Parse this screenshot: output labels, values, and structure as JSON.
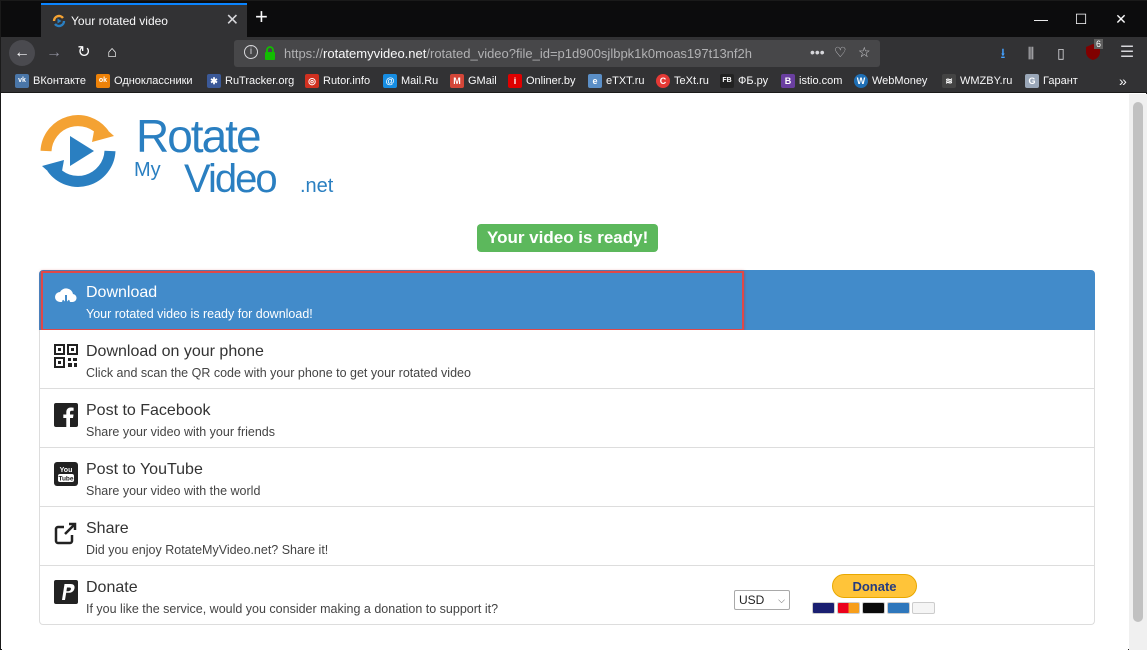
{
  "browser": {
    "tab_title": "Your rotated video",
    "url_prefix": "https://",
    "url_domain": "rotatemyvideo.net",
    "url_path": "/rotated_video?file_id=p1d900sjlbpk1k0moas197t13nf2h",
    "ublock_count": "6"
  },
  "bookmarks": [
    {
      "label": "ВКонтакте",
      "color": "#4a76a8",
      "glyph": "vk"
    },
    {
      "label": "Одноклассники",
      "color": "#ee8208",
      "glyph": "ok"
    },
    {
      "label": "RuTracker.org",
      "color": "#3b5998",
      "glyph": "✱"
    },
    {
      "label": "Rutor.info",
      "color": "#d03020",
      "glyph": "◎"
    },
    {
      "label": "Mail.Ru",
      "color": "#168de2",
      "glyph": "@"
    },
    {
      "label": "GMail",
      "color": "#d44638",
      "glyph": "M"
    },
    {
      "label": "Onliner.by",
      "color": "#e00000",
      "glyph": "i"
    },
    {
      "label": "eTXT.ru",
      "color": "#5b8fc7",
      "glyph": "e"
    },
    {
      "label": "TeXt.ru",
      "color": "#e53935",
      "glyph": "C"
    },
    {
      "label": "ФБ.ру",
      "color": "#222222",
      "glyph": "FB"
    },
    {
      "label": "istio.com",
      "color": "#6a3fa0",
      "glyph": "B"
    },
    {
      "label": "WebMoney",
      "color": "#1f6fb5",
      "glyph": "W"
    },
    {
      "label": "WMZBY.ru",
      "color": "#444444",
      "glyph": "≋"
    },
    {
      "label": "Гарант",
      "color": "#9aa7b8",
      "glyph": "G"
    }
  ],
  "page": {
    "ready_badge": "Your video is ready!",
    "options": [
      {
        "title": "Download",
        "subtitle": "Your rotated video is ready for download!",
        "icon": "cloud-download-icon"
      },
      {
        "title": "Download on your phone",
        "subtitle": "Click and scan the QR code with your phone to get your rotated video",
        "icon": "qr-code-icon"
      },
      {
        "title": "Post to Facebook",
        "subtitle": "Share your video with your friends",
        "icon": "facebook-icon"
      },
      {
        "title": "Post to YouTube",
        "subtitle": "Share your video with the world",
        "icon": "youtube-icon"
      },
      {
        "title": "Share",
        "subtitle": "Did you enjoy RotateMyVideo.net? Share it!",
        "icon": "share-icon"
      },
      {
        "title": "Donate",
        "subtitle": "If you like the service, would you consider making a donation to support it?",
        "icon": "paypal-icon"
      }
    ],
    "donate": {
      "currency": "USD",
      "button_label": "Donate"
    }
  },
  "colors": {
    "accent_blue": "#428bca",
    "ready_green": "#5cb85c",
    "highlight_red": "#e04848",
    "paypal_yellow": "#ffc439",
    "logo_orange": "#f4a233",
    "logo_blue": "#2a7fc1"
  }
}
